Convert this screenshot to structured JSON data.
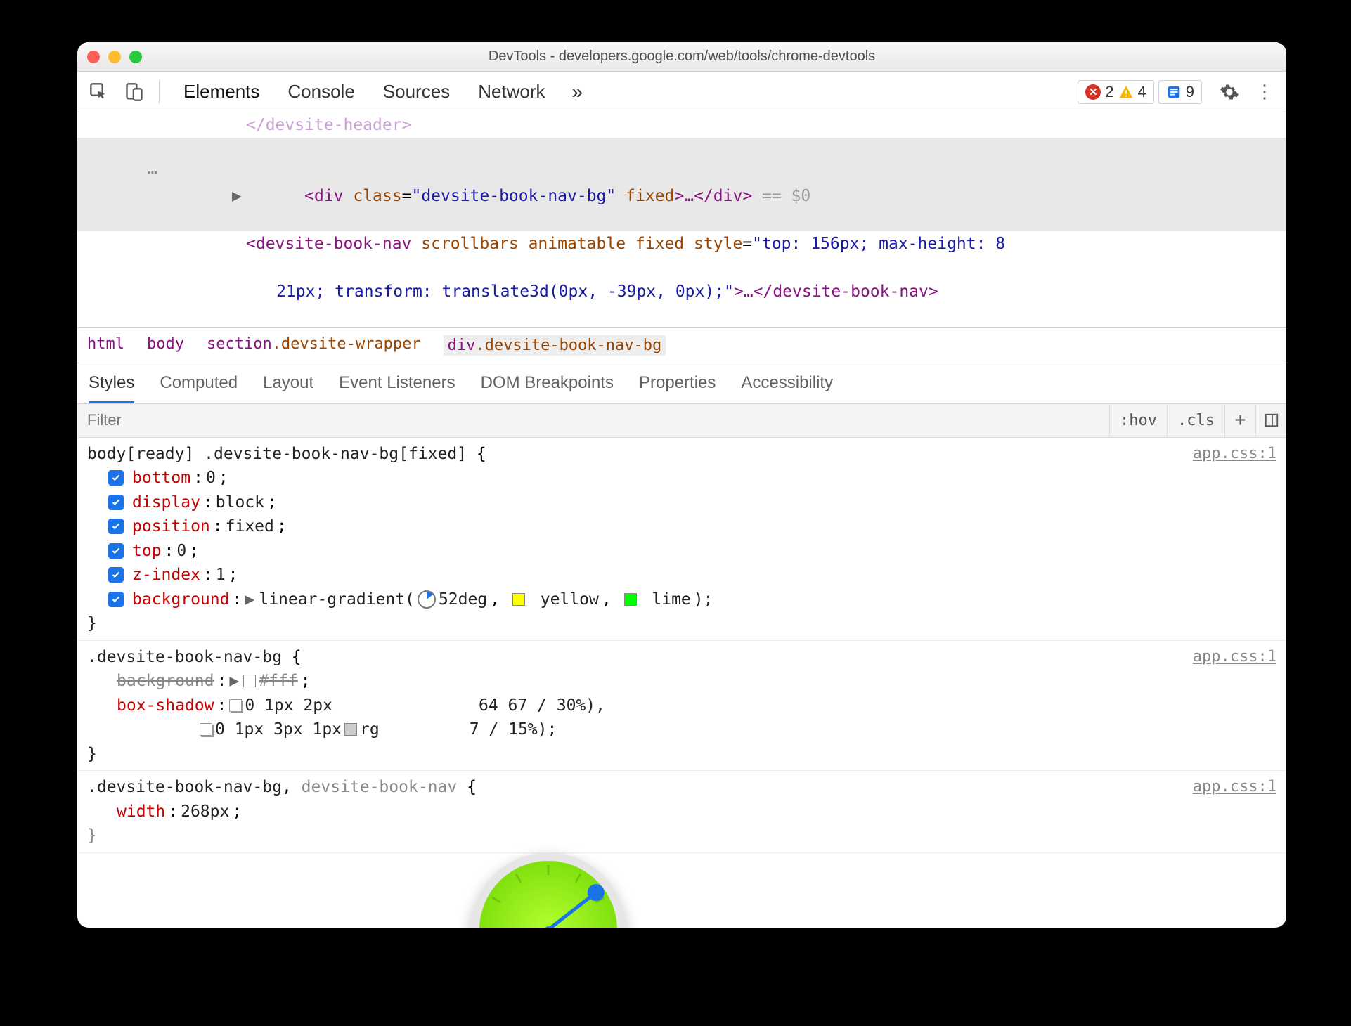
{
  "window": {
    "title": "DevTools - developers.google.com/web/tools/chrome-devtools"
  },
  "toolbar": {
    "tabs": [
      "Elements",
      "Console",
      "Sources",
      "Network"
    ],
    "active_tab": 0,
    "errors": "2",
    "warnings": "4",
    "issues": "9"
  },
  "dom": {
    "line0": "</devsite-header>",
    "sel_open": "<div",
    "sel_attr_name": "class",
    "sel_attr_val": "devsite-book-nav-bg",
    "sel_attr2": "fixed",
    "sel_mid": ">…</div>",
    "sel_suffix": " == $0",
    "line2a": "<devsite-book-nav",
    "line2b": "scrollbars animatable fixed",
    "line2_style_attr": "style",
    "line2_style_val": "top: 156px; max-height: 8",
    "line3_cont": "21px; transform: translate3d(0px, -39px, 0px);",
    "line3_close": ">…</devsite-book-nav>"
  },
  "breadcrumbs": [
    {
      "tag": "html",
      "cls": ""
    },
    {
      "tag": "body",
      "cls": ""
    },
    {
      "tag": "section",
      "cls": ".devsite-wrapper"
    },
    {
      "tag": "div",
      "cls": ".devsite-book-nav-bg"
    }
  ],
  "subtabs": [
    "Styles",
    "Computed",
    "Layout",
    "Event Listeners",
    "DOM Breakpoints",
    "Properties",
    "Accessibility"
  ],
  "active_subtab": 0,
  "filter": {
    "placeholder": "Filter",
    "hov": ":hov",
    "cls": ".cls"
  },
  "rules": [
    {
      "selector": "body[ready] .devsite-book-nav-bg[fixed]",
      "source": "app.css:1",
      "decls": [
        {
          "prop": "bottom",
          "val": "0"
        },
        {
          "prop": "display",
          "val": "block"
        },
        {
          "prop": "position",
          "val": "fixed"
        },
        {
          "prop": "top",
          "val": "0"
        },
        {
          "prop": "z-index",
          "val": "1"
        }
      ],
      "gradient": {
        "prop": "background",
        "fn": "linear-gradient(",
        "angle": "52deg",
        "stop1": "yellow",
        "stop2": "lime",
        "close": ");"
      }
    },
    {
      "selector": ".devsite-book-nav-bg",
      "source": "app.css:1",
      "struck": {
        "prop": "background",
        "val": "#fff"
      },
      "shadow": {
        "prop": "box-shadow",
        "l1": "0 1px 2px ",
        "l1b": "64 67 / 30%),",
        "l2": "0 1px 3px 1px ",
        "l2b": "rg",
        "l2c": "7 / 15%);"
      }
    },
    {
      "selector_a": ".devsite-book-nav-bg",
      "selector_b": "devsite-book-nav",
      "source": "app.css:1",
      "decl": {
        "prop": "width",
        "val": "268px"
      }
    }
  ]
}
